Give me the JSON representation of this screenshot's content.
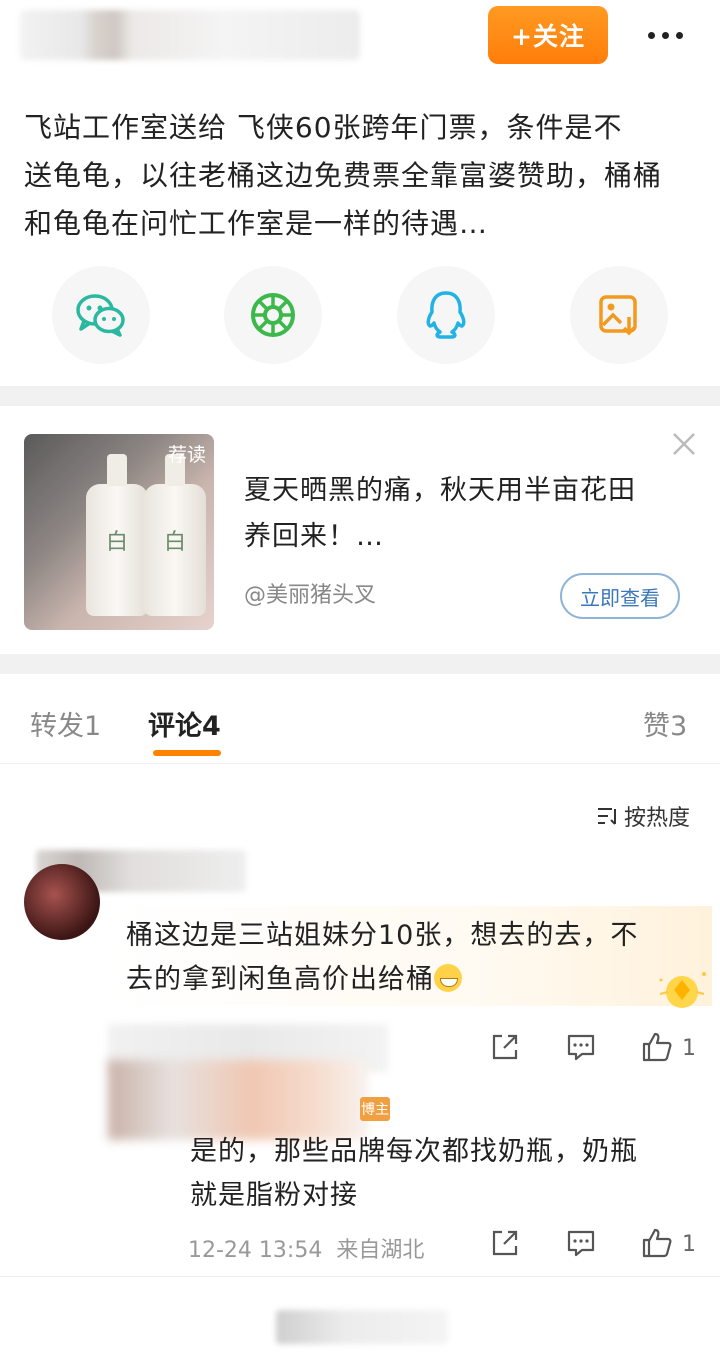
{
  "header": {
    "follow_label": "+关注"
  },
  "post": {
    "lines": [
      "飞站工作室送给  飞侠60张跨年门票，条件是不",
      "送龟龟，以往老桶这边免费票全靠富婆赞助，桶桶",
      "和龟龟在问忙工作室是一样的待遇…"
    ]
  },
  "share": {
    "icons": [
      "wechat-icon",
      "moments-icon",
      "qq-icon",
      "save-image-icon"
    ]
  },
  "ad": {
    "tag": "荐读",
    "title_lines": [
      "夏天晒黑的痛，秋天用半亩花田",
      "养回来！…"
    ],
    "author": "@美丽猪头叉",
    "button": "立即查看",
    "bottle_label": "白"
  },
  "tabs": {
    "repost": "转发1",
    "comments": "评论4",
    "likes": "赞3"
  },
  "sort": {
    "label": "按热度"
  },
  "comment": {
    "lines": [
      "桶这边是三站姐妹分10张，想去的去，不",
      "去的拿到闲鱼高价出给桶"
    ],
    "like_count": "1"
  },
  "reply": {
    "author_tag": "博主",
    "lines": [
      "是的，那些品牌每次都找奶瓶，奶瓶",
      "就是脂粉对接"
    ],
    "time": "12-24 13:54",
    "location": "来自湖北",
    "like_count": "1"
  },
  "colors": {
    "accent": "#ff8200",
    "link": "#3b78b8"
  }
}
